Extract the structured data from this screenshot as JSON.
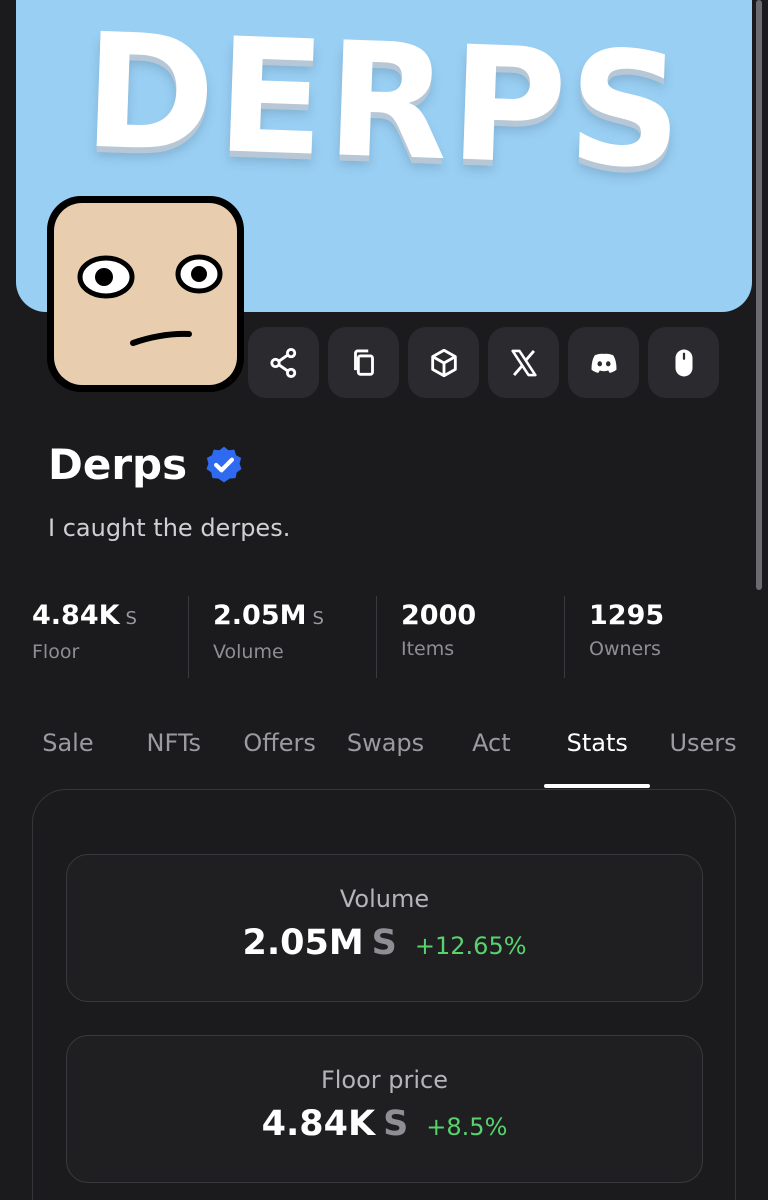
{
  "banner": {
    "text": "DERPS",
    "bg_color": "#99cff3"
  },
  "collection": {
    "title": "Derps",
    "description": "I caught the derpes.",
    "verified_color": "#2f6bf0"
  },
  "actions": [
    {
      "icon": "share-icon"
    },
    {
      "icon": "copy-icon"
    },
    {
      "icon": "cube-icon"
    },
    {
      "icon": "x-logo-icon"
    },
    {
      "icon": "discord-icon"
    },
    {
      "icon": "mouse-icon"
    }
  ],
  "stats": [
    {
      "value": "4.84K",
      "unit": "S",
      "label": "Floor"
    },
    {
      "value": "2.05M",
      "unit": "S",
      "label": "Volume"
    },
    {
      "value": "2000",
      "unit": "",
      "label": "Items"
    },
    {
      "value": "1295",
      "unit": "",
      "label": "Owners"
    }
  ],
  "tabs": [
    {
      "label": "Sale",
      "active": false
    },
    {
      "label": "NFTs",
      "active": false
    },
    {
      "label": "Offers",
      "active": false
    },
    {
      "label": "Swaps",
      "active": false
    },
    {
      "label": "Act",
      "active": false
    },
    {
      "label": "Stats",
      "active": true
    },
    {
      "label": "Users",
      "active": false
    }
  ],
  "cards": [
    {
      "label": "Volume",
      "value": "2.05M",
      "unit": "S",
      "change": "+12.65%"
    },
    {
      "label": "Floor price",
      "value": "4.84K",
      "unit": "S",
      "change": "+8.5%"
    }
  ],
  "colors": {
    "positive": "#57d26d",
    "background": "#1b1b1d"
  }
}
